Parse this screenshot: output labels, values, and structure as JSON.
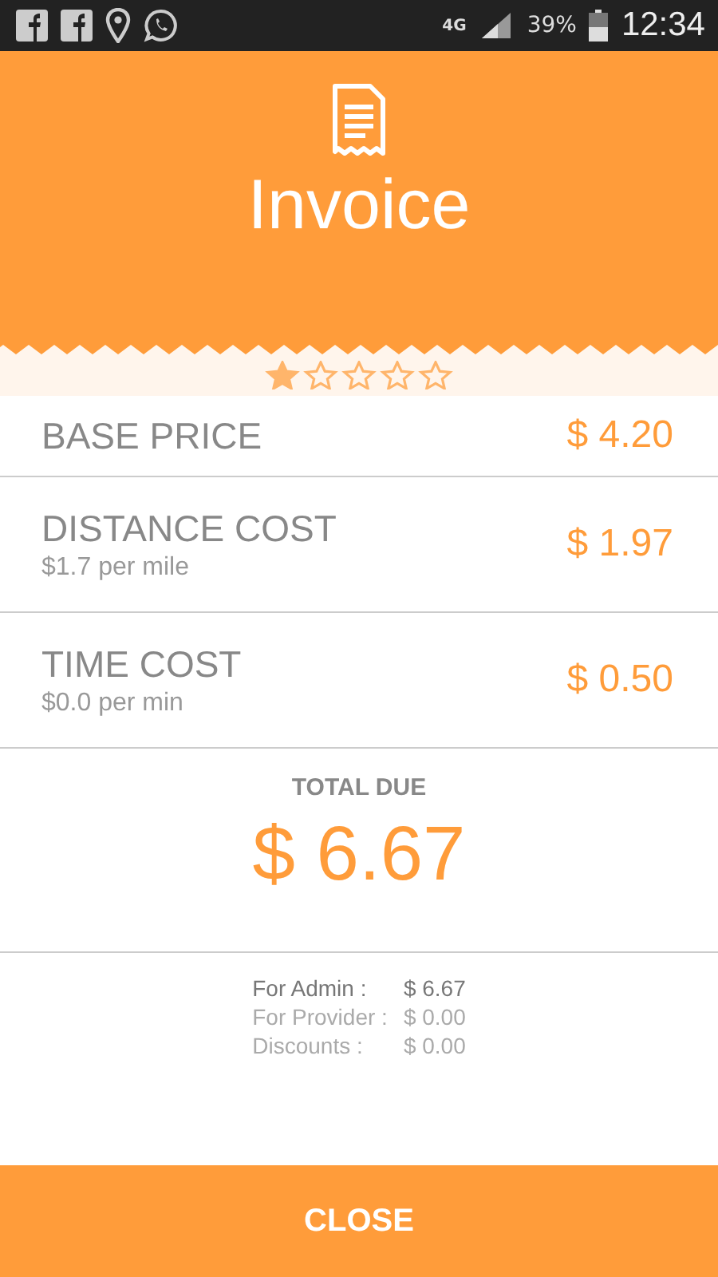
{
  "status_bar": {
    "network": "4G",
    "battery": "39%",
    "time": "12:34"
  },
  "header": {
    "title": "Invoice"
  },
  "rating": {
    "stars": 1
  },
  "charges": [
    {
      "label": "BASE PRICE",
      "amount": "$ 4.20"
    },
    {
      "label": "DISTANCE COST",
      "rate": "$1.7 per mile",
      "amount": "$ 1.97"
    },
    {
      "label": "TIME COST",
      "rate": "$0.0 per min",
      "amount": "$ 0.50"
    }
  ],
  "total": {
    "label": "TOTAL DUE",
    "amount": "$ 6.67"
  },
  "breakdown": [
    {
      "label": "For Admin :",
      "amount": "$ 6.67",
      "emphasis": true
    },
    {
      "label": "For Provider :",
      "amount": "$ 0.00",
      "emphasis": false
    },
    {
      "label": "Discounts :",
      "amount": "$ 0.00",
      "emphasis": false
    }
  ],
  "close_button": "CLOSE"
}
